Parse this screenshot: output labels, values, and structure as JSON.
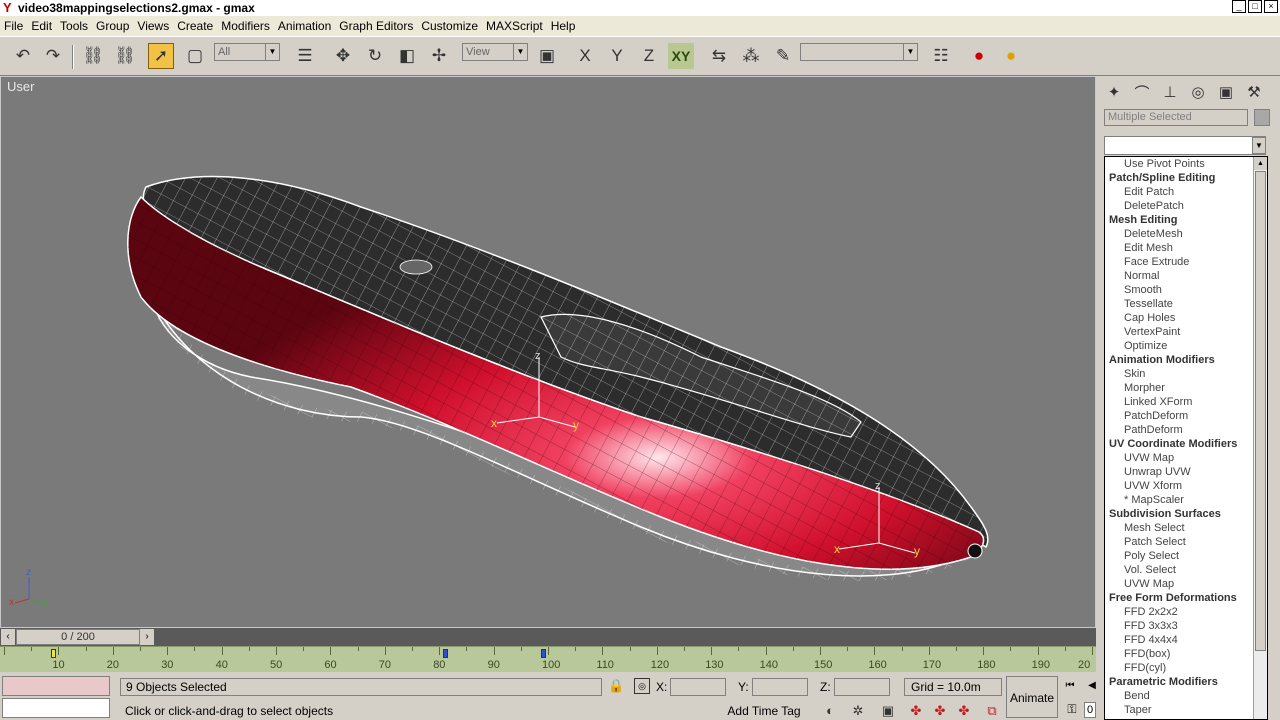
{
  "window": {
    "title": "video38mappingselections2.gmax - gmax",
    "app_icon": "gmax-icon",
    "controls": [
      "_",
      "□",
      "×"
    ]
  },
  "menu": [
    "File",
    "Edit",
    "Tools",
    "Group",
    "Views",
    "Create",
    "Modifiers",
    "Animation",
    "Graph Editors",
    "Customize",
    "MAXScript",
    "Help"
  ],
  "toolbar": {
    "selection_filter": "All",
    "reference_coord": "View",
    "axis_x": "X",
    "axis_y": "Y",
    "axis_z": "Z",
    "axis_xy": "XY"
  },
  "viewport": {
    "label": "User",
    "axis_labels": {
      "x": "x",
      "y": "y",
      "z": "z"
    },
    "object_color": "#e0103a"
  },
  "command_panel": {
    "name_field": "Multiple Selected",
    "dropdown_items": [
      {
        "type": "item",
        "label": "Use Pivot Points"
      },
      {
        "type": "head",
        "label": "Patch/Spline Editing"
      },
      {
        "type": "item",
        "label": "Edit Patch"
      },
      {
        "type": "item",
        "label": "DeletePatch"
      },
      {
        "type": "head",
        "label": "Mesh Editing"
      },
      {
        "type": "item",
        "label": "DeleteMesh"
      },
      {
        "type": "item",
        "label": "Edit Mesh"
      },
      {
        "type": "item",
        "label": "Face Extrude"
      },
      {
        "type": "item",
        "label": "Normal"
      },
      {
        "type": "item",
        "label": "Smooth"
      },
      {
        "type": "item",
        "label": "Tessellate"
      },
      {
        "type": "item",
        "label": "Cap Holes"
      },
      {
        "type": "item",
        "label": "VertexPaint"
      },
      {
        "type": "item",
        "label": "Optimize"
      },
      {
        "type": "head",
        "label": "Animation Modifiers"
      },
      {
        "type": "item",
        "label": "Skin"
      },
      {
        "type": "item",
        "label": "Morpher"
      },
      {
        "type": "item",
        "label": "Linked XForm"
      },
      {
        "type": "item",
        "label": "PatchDeform"
      },
      {
        "type": "item",
        "label": "PathDeform"
      },
      {
        "type": "head",
        "label": "UV Coordinate Modifiers"
      },
      {
        "type": "item",
        "label": "UVW Map"
      },
      {
        "type": "item",
        "label": "Unwrap UVW"
      },
      {
        "type": "item",
        "label": "UVW Xform"
      },
      {
        "type": "item",
        "label": "* MapScaler"
      },
      {
        "type": "head",
        "label": "Subdivision Surfaces"
      },
      {
        "type": "item",
        "label": "Mesh Select"
      },
      {
        "type": "item",
        "label": "Patch Select"
      },
      {
        "type": "item",
        "label": "Poly Select"
      },
      {
        "type": "item",
        "label": "Vol. Select"
      },
      {
        "type": "item",
        "label": "UVW Map"
      },
      {
        "type": "head",
        "label": "Free Form Deformations"
      },
      {
        "type": "item",
        "label": "FFD 2x2x2"
      },
      {
        "type": "item",
        "label": "FFD 3x3x3"
      },
      {
        "type": "item",
        "label": "FFD 4x4x4"
      },
      {
        "type": "item",
        "label": "FFD(box)"
      },
      {
        "type": "item",
        "label": "FFD(cyl)"
      },
      {
        "type": "head",
        "label": "Parametric Modifiers"
      },
      {
        "type": "item",
        "label": "Bend"
      },
      {
        "type": "item",
        "label": "Taper"
      }
    ]
  },
  "timeline": {
    "slider_text": "0 / 200",
    "ticks": [
      "10",
      "20",
      "30",
      "40",
      "50",
      "60",
      "70",
      "80",
      "90",
      "100",
      "110",
      "120",
      "130",
      "140",
      "150",
      "160",
      "170",
      "180",
      "190",
      "20"
    ]
  },
  "status": {
    "selection": "9 Objects Selected",
    "prompt": "Click or click-and-drag to select objects",
    "x_label": "X:",
    "y_label": "Y:",
    "z_label": "Z:",
    "grid": "Grid = 10.0m",
    "add_time_tag": "Add Time Tag",
    "animate": "Animate",
    "frame": "0"
  }
}
